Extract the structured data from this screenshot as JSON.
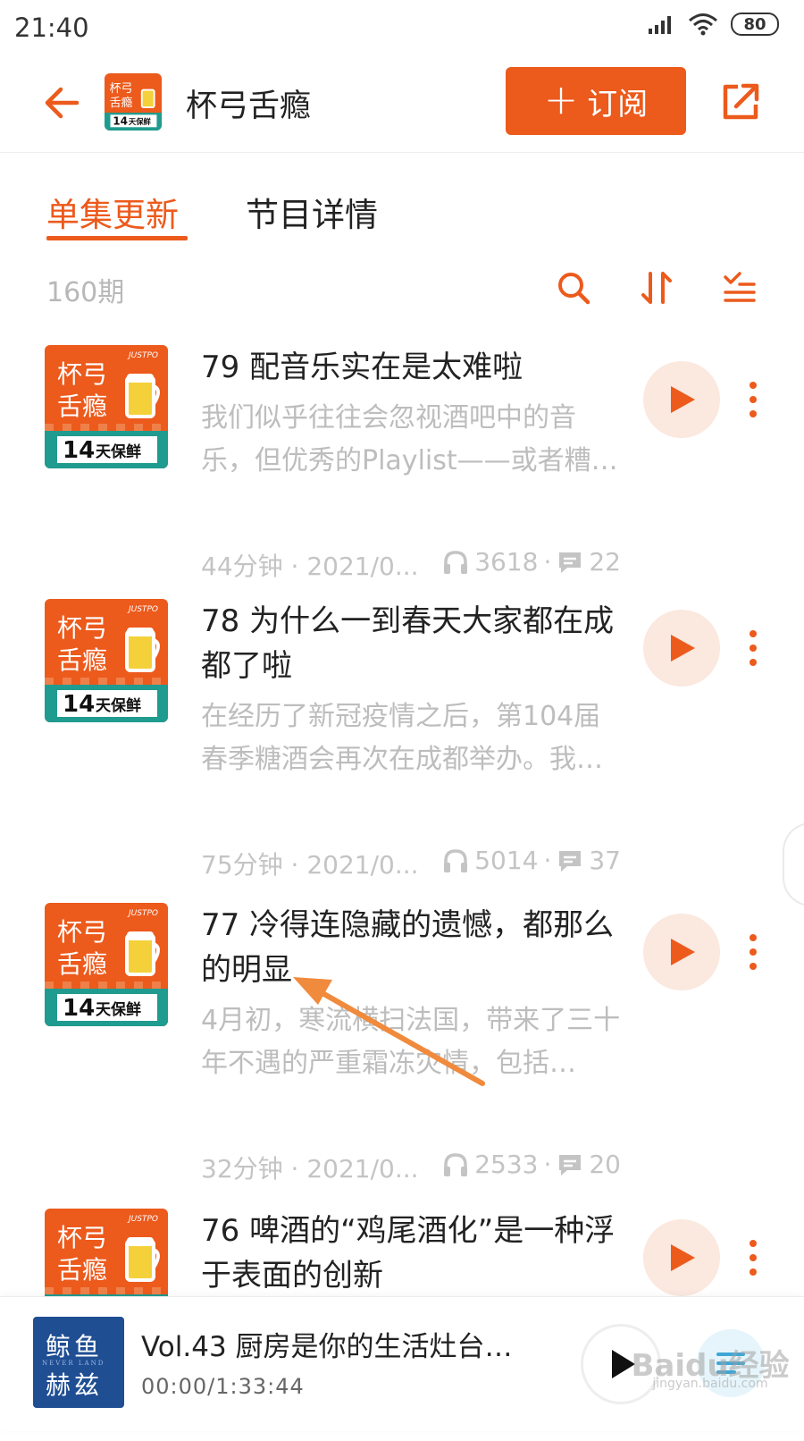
{
  "status_bar": {
    "time": "21:40",
    "battery": "80"
  },
  "header": {
    "title": "杯弓舌瘾",
    "subscribe_label": "订阅"
  },
  "cover_art": {
    "title_line1": "杯弓",
    "title_line2": "舌瘾",
    "badge_number": "14",
    "badge_text": "天保鲜",
    "brand": "JUSTPO"
  },
  "tabs": [
    {
      "label": "单集更新",
      "active": true
    },
    {
      "label": "节目详情",
      "active": false
    }
  ],
  "toolbar": {
    "episode_count": "160期"
  },
  "episodes": [
    {
      "title": "79 配音乐实在是太难啦",
      "description": "我们似乎往往会忽视酒吧中的音乐，但优秀的Playlist——或者糟…",
      "duration_date": "44分钟 · 2021/0...",
      "plays": "3618",
      "comments": "22"
    },
    {
      "title": "78 为什么一到春天大家都在成都了啦",
      "description": "在经历了新冠疫情之后，第104届春季糖酒会再次在成都举办。我…",
      "duration_date": "75分钟 · 2021/0...",
      "plays": "5014",
      "comments": "37"
    },
    {
      "title": "77 冷得连隐藏的遗憾，都那么的明显",
      "description": "4月初，寒流横扫法国，带来了三十年不遇的严重霜冻灾情，包括…",
      "duration_date": "32分钟 · 2021/0...",
      "plays": "2533",
      "comments": "20"
    },
    {
      "title": "76 啤酒的“鸡尾酒化”是一种浮于表面的创新",
      "description": "",
      "duration_date": "",
      "plays": "",
      "comments": ""
    }
  ],
  "mini_player": {
    "cover_line1": "鲸鱼",
    "cover_line2": "赫兹",
    "cover_small": "NEVER LAND",
    "title": "Vol.43 厨房是你的生活灶台，...",
    "time": "00:00/1:33:44"
  },
  "watermark": {
    "main": "Baidu经验",
    "sub": "jingyan.baidu.com"
  },
  "colors": {
    "accent": "#ec5a1c",
    "cover_orange": "#ec5a1c",
    "cover_teal": "#1f9b8f",
    "mini_cover_blue": "#1f4e93"
  },
  "icons": [
    "back-arrow-icon",
    "share-icon",
    "search-icon",
    "sort-icon",
    "filter-list-icon",
    "headphones-icon",
    "comment-icon",
    "play-icon",
    "more-vertical-icon",
    "playlist-icon"
  ]
}
